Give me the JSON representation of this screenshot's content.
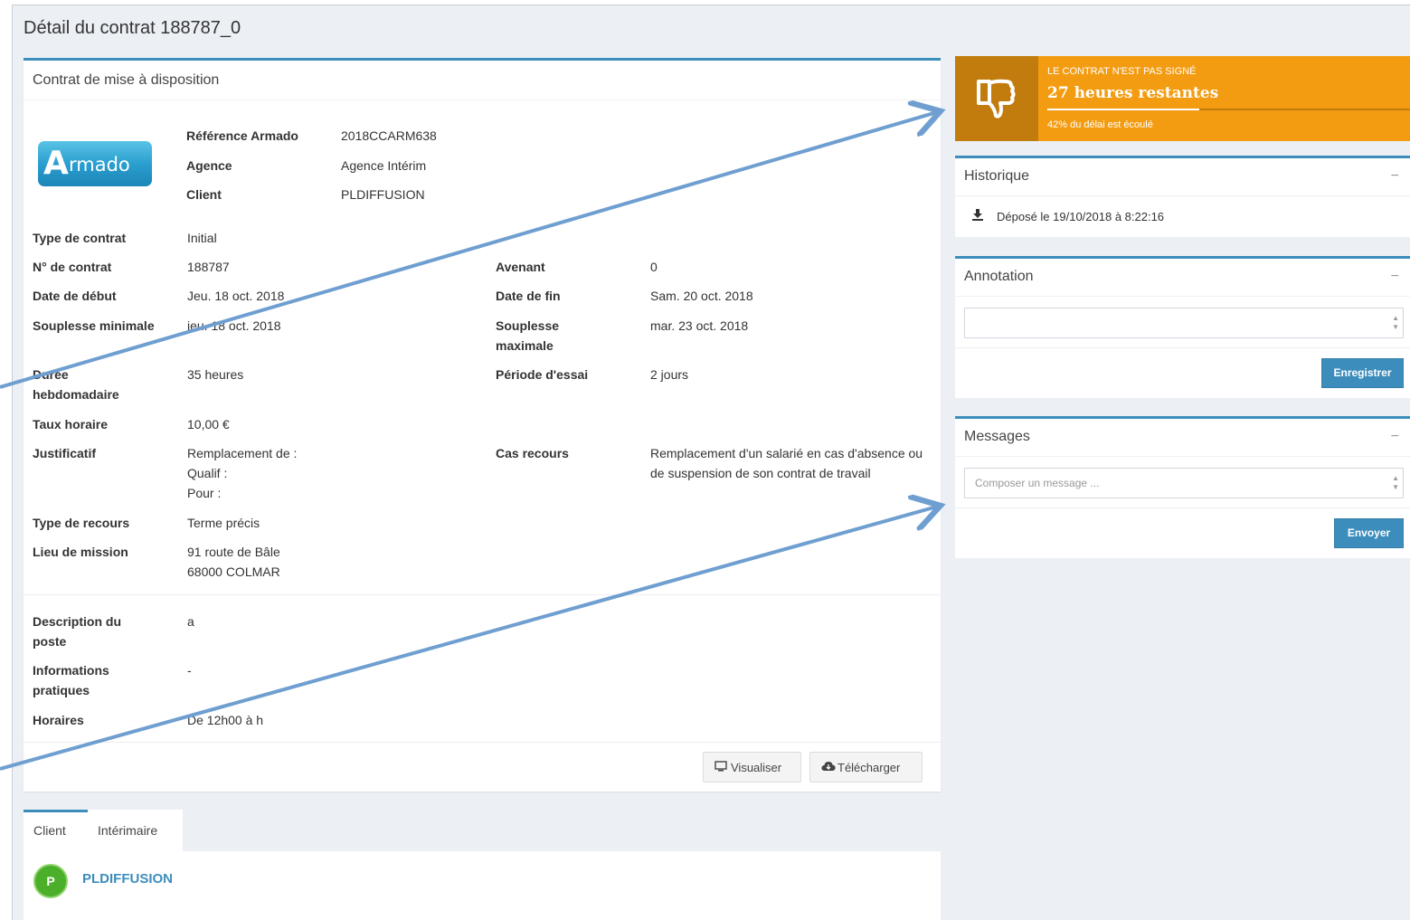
{
  "page": {
    "title": "Détail du contrat 188787_0"
  },
  "contract": {
    "panel_title": "Contrat de mise à disposition",
    "logo_text": "Armado",
    "header_fields": [
      {
        "label": "Référence Armado",
        "value": "2018CCARM638"
      },
      {
        "label": "Agence",
        "value": "Agence Intérim"
      },
      {
        "label": "Client",
        "value": "PLDIFFUSION"
      }
    ],
    "fields": {
      "type_contrat": {
        "label": "Type de contrat",
        "value": "Initial"
      },
      "num_contrat": {
        "label": "N° de contrat",
        "value": "188787"
      },
      "avenant": {
        "label": "Avenant",
        "value": "0"
      },
      "date_debut": {
        "label": "Date de début",
        "value": "Jeu. 18 oct. 2018"
      },
      "date_fin": {
        "label": "Date de fin",
        "value": "Sam. 20 oct. 2018"
      },
      "souplesse_min": {
        "label": "Souplesse minimale",
        "value": "jeu. 18 oct. 2018"
      },
      "souplesse_max": {
        "label_1": "Souplesse",
        "label_2": "maximale",
        "value": "mar. 23 oct. 2018"
      },
      "duree": {
        "label_1": "Durée",
        "label_2": "hebdomadaire",
        "value": "35 heures"
      },
      "periode_essai": {
        "label": "Période d'essai",
        "value": "2 jours"
      },
      "taux_horaire": {
        "label": "Taux horaire",
        "value": "10,00 €"
      },
      "justificatif": {
        "label": "Justificatif",
        "value_1": "Remplacement de :",
        "value_2": "Qualif :",
        "value_3": "Pour :"
      },
      "cas_recours": {
        "label": "Cas recours",
        "value_1": "Remplacement d'un salarié en cas d'absence ou",
        "value_2": "de suspension de son contrat de travail"
      },
      "type_recours": {
        "label": "Type de recours",
        "value": "Terme précis"
      },
      "lieu_mission": {
        "label": "Lieu de mission",
        "value_1": "91 route de Bâle",
        "value_2": "68000 COLMAR"
      },
      "description": {
        "label_1": "Description du",
        "label_2": "poste",
        "value": "a"
      },
      "informations": {
        "label_1": "Informations",
        "label_2": "pratiques",
        "value": "-"
      },
      "horaires": {
        "label": "Horaires",
        "value": "De 12h00 à h"
      }
    },
    "buttons": {
      "visualiser": "Visualiser",
      "telecharger": "Télécharger"
    }
  },
  "tabs": {
    "items": [
      {
        "label": "Client"
      },
      {
        "label": "Intérimaire"
      }
    ],
    "client": {
      "initial": "P",
      "name": "PLDIFFUSION"
    }
  },
  "status": {
    "label": "LE CONTRAT N'EST PAS SIGNÉ",
    "title": "27 heures restantes",
    "progress_percent": 42,
    "description": "42% du délai est écoulé",
    "color": "#f39c12"
  },
  "historique": {
    "title": "Historique",
    "collapse": "−",
    "entries": [
      {
        "icon": "download-icon",
        "text": "Déposé le 19/10/2018 à 8:22:16"
      }
    ]
  },
  "annotation": {
    "title": "Annotation",
    "collapse": "−",
    "value": "",
    "button": "Enregistrer"
  },
  "messages": {
    "title": "Messages",
    "collapse": "−",
    "placeholder": "Composer un message ...",
    "button": "Envoyer"
  },
  "colors": {
    "accent": "#3c8dbc",
    "background": "#ecf0f5",
    "warning": "#f39c12",
    "avatar": "#4caf2a",
    "arrow": "#6f9fd0"
  }
}
